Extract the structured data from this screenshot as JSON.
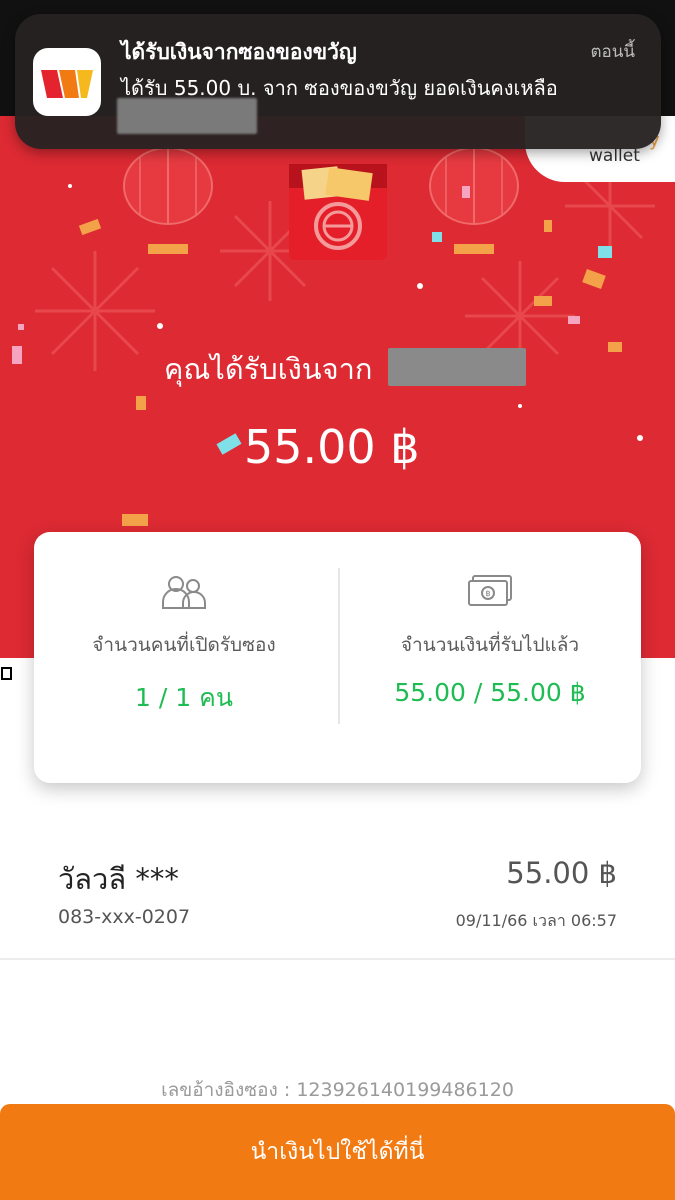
{
  "notification": {
    "app_icon": "truemoney-wallet-icon",
    "title": "ได้รับเงินจากซองของขวัญ",
    "time": "ตอนนี้",
    "body": "ได้รับ 55.00 บ. จาก ซองของขวัญ ยอดเงินคงเหลือ"
  },
  "header": {
    "brand_text": "wallet"
  },
  "hero": {
    "from_label": "คุณได้รับเงินจาก",
    "amount": "55.00 ฿"
  },
  "summary": {
    "openers_label": "จำนวนคนที่เปิดรับซอง",
    "openers_value": "1 / 1 คน",
    "received_label": "จำนวนเงินที่รับไปแล้ว",
    "received_value": "55.00  /  55.00 ฿"
  },
  "recipients": [
    {
      "name": "วัลวลี ***",
      "phone": "083-xxx-0207",
      "amount": "55.00 ฿",
      "date": "09/11/66 เวลา 06:57"
    }
  ],
  "footer": {
    "reference": "เลขอ้างอิงซอง : 123926140199486120",
    "cta_label": "นำเงินไปใช้ได้ที่นี่"
  },
  "colors": {
    "hero_red": "#dd2a33",
    "accent_green": "#1ebc52",
    "cta_orange": "#f27a13"
  }
}
